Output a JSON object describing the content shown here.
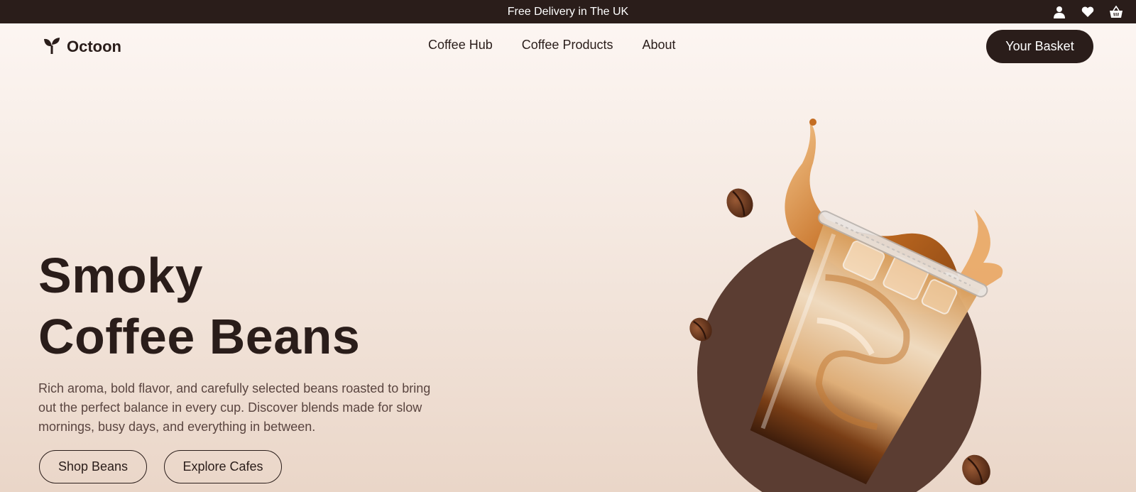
{
  "topbar": {
    "message": "Free Delivery in The UK",
    "icons": [
      "user-icon",
      "heart-icon",
      "basket-icon"
    ]
  },
  "brand": {
    "name": "Octoon",
    "icon": "sprout-icon"
  },
  "nav": {
    "items": [
      {
        "label": "Coffee Hub"
      },
      {
        "label": "Coffee Products"
      },
      {
        "label": "About"
      }
    ],
    "basket_label": "Your Basket"
  },
  "hero": {
    "title_line1": "Smoky",
    "title_line2": "Coffee Beans",
    "description": "Rich aroma, bold flavor, and carefully selected beans roasted to bring out the perfect balance in every cup. Discover blends made for slow mornings, busy days, and everything in between.",
    "primary_button": "Shop Beans",
    "secondary_button": "Explore Cafes"
  },
  "colors": {
    "dark_brown": "#2a1d1a",
    "circle_brown": "#5b3d32",
    "caramel": "#c77a2c",
    "cream": "#f3dcc0"
  }
}
